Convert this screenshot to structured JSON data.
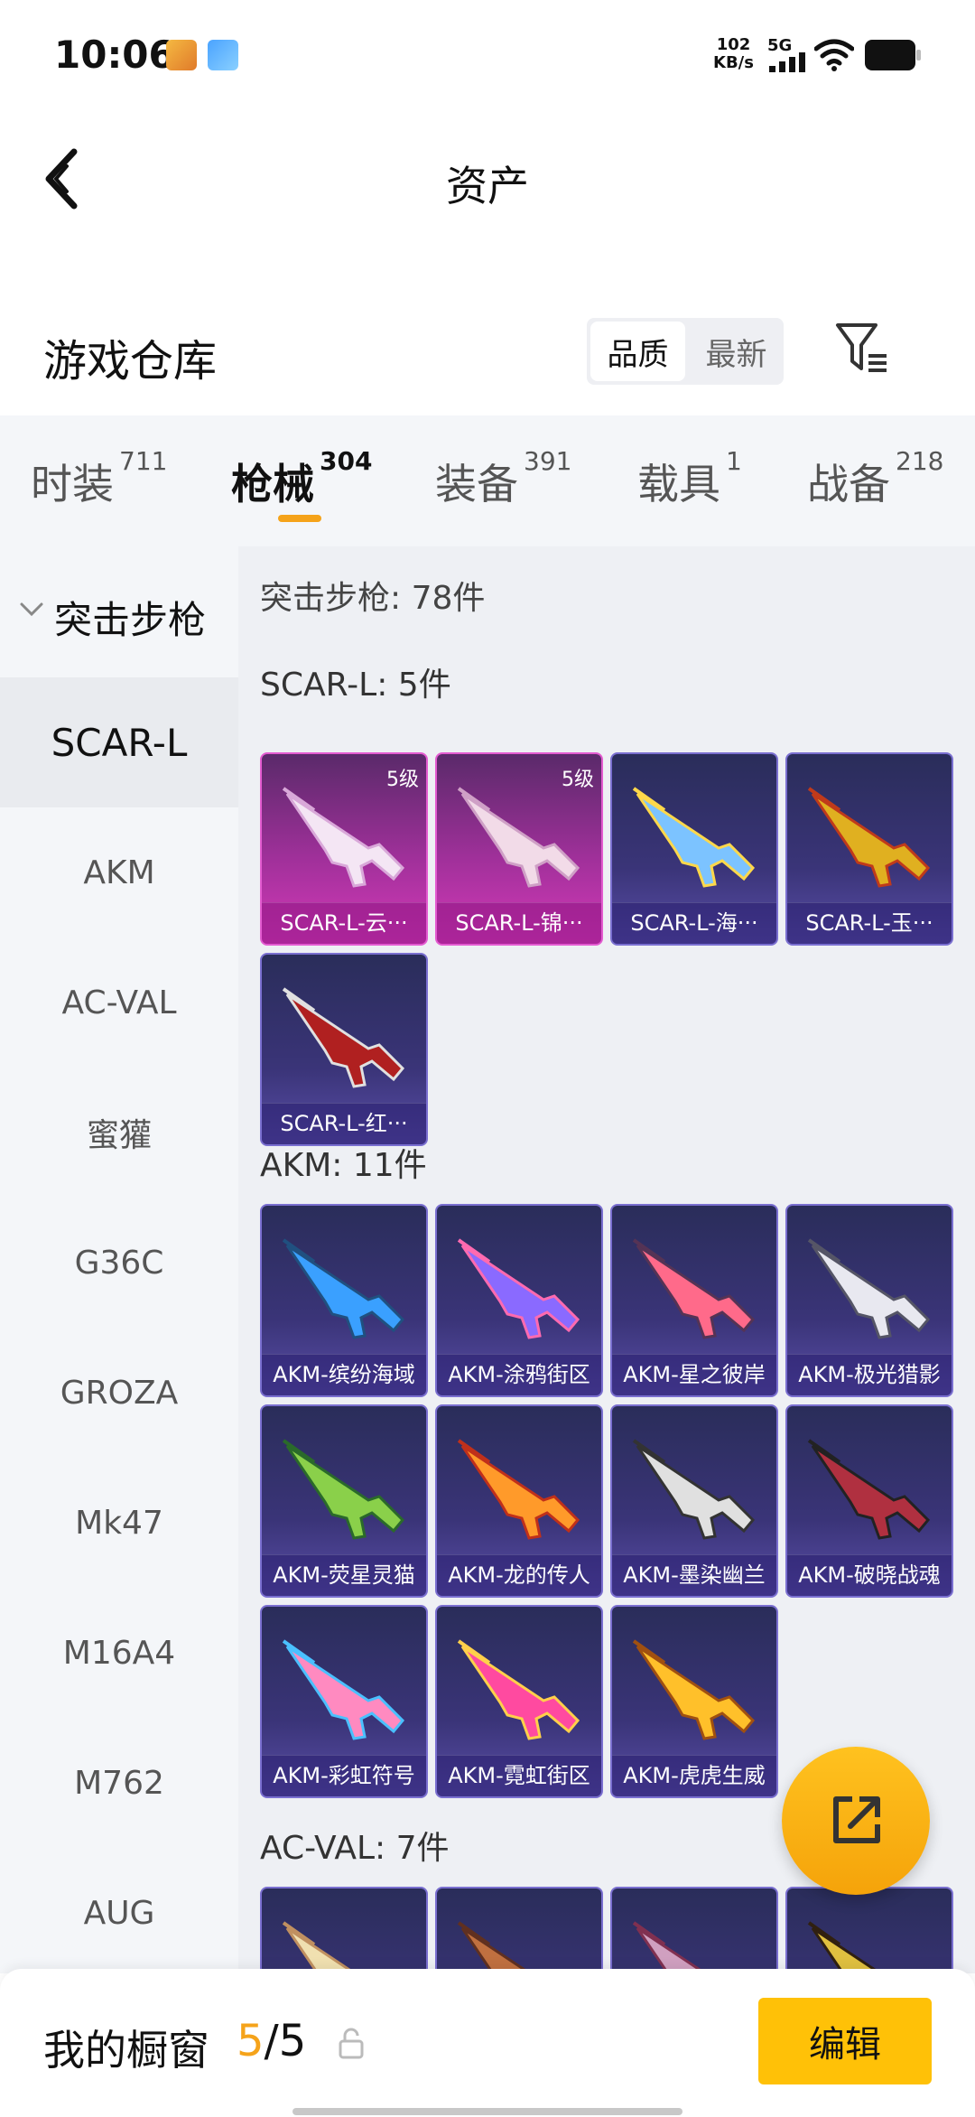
{
  "status_bar": {
    "time": "10:06",
    "net_speed_value": "102",
    "net_speed_unit": "KB/s",
    "network": "5G"
  },
  "header": {
    "title": "资产"
  },
  "warehouse": {
    "title": "游戏仓库",
    "sort_options": [
      "品质",
      "最新"
    ],
    "sort_selected": "品质"
  },
  "tabs": [
    {
      "label": "时装",
      "count": "711"
    },
    {
      "label": "枪械",
      "count": "304"
    },
    {
      "label": "装备",
      "count": "391"
    },
    {
      "label": "载具",
      "count": "1"
    },
    {
      "label": "战备",
      "count": "218"
    }
  ],
  "active_tab": "枪械",
  "sidebar": {
    "group": "突击步枪",
    "items": [
      "SCAR-L",
      "AKM",
      "AC-VAL",
      "蜜獾",
      "G36C",
      "GROZA",
      "Mk47",
      "M16A4",
      "M762",
      "AUG"
    ],
    "selected": "SCAR-L"
  },
  "content": {
    "summary": "突击步枪: 78件",
    "sections": [
      {
        "title": "SCAR-L: 5件",
        "items": [
          {
            "name": "SCAR-L-云···",
            "level": "5级",
            "quality": "legendary"
          },
          {
            "name": "SCAR-L-锦···",
            "level": "5级",
            "quality": "legendary"
          },
          {
            "name": "SCAR-L-海···",
            "level": "",
            "quality": "epic"
          },
          {
            "name": "SCAR-L-玉···",
            "level": "",
            "quality": "epic"
          },
          {
            "name": "SCAR-L-红···",
            "level": "",
            "quality": "epic"
          }
        ]
      },
      {
        "title": "AKM: 11件",
        "items": [
          {
            "name": "AKM-缤纷海域",
            "level": "",
            "quality": "epic"
          },
          {
            "name": "AKM-涂鸦街区",
            "level": "",
            "quality": "epic"
          },
          {
            "name": "AKM-星之彼岸",
            "level": "",
            "quality": "epic"
          },
          {
            "name": "AKM-极光猎影",
            "level": "",
            "quality": "epic"
          },
          {
            "name": "AKM-荧星灵猫",
            "level": "",
            "quality": "epic"
          },
          {
            "name": "AKM-龙的传人",
            "level": "",
            "quality": "epic"
          },
          {
            "name": "AKM-墨染幽兰",
            "level": "",
            "quality": "epic"
          },
          {
            "name": "AKM-破晓战魂",
            "level": "",
            "quality": "epic"
          },
          {
            "name": "AKM-彩虹符号",
            "level": "",
            "quality": "epic"
          },
          {
            "name": "AKM-霓虹街区",
            "level": "",
            "quality": "epic"
          },
          {
            "name": "AKM-虎虎生威",
            "level": "",
            "quality": "epic"
          }
        ]
      },
      {
        "title": "AC-VAL: 7件",
        "items": [
          {
            "name": "",
            "level": "",
            "quality": "epic"
          },
          {
            "name": "",
            "level": "",
            "quality": "epic"
          },
          {
            "name": "",
            "level": "",
            "quality": "epic"
          },
          {
            "name": "",
            "level": "",
            "quality": "epic"
          }
        ]
      }
    ]
  },
  "bottom_bar": {
    "label": "我的橱窗",
    "current": "5",
    "total": "5",
    "edit_label": "编辑"
  },
  "colors": {
    "accent": "#f5a31a",
    "edit_button": "#ffc107",
    "card_epic": "#3a3478",
    "card_legendary": "#a0309a"
  }
}
